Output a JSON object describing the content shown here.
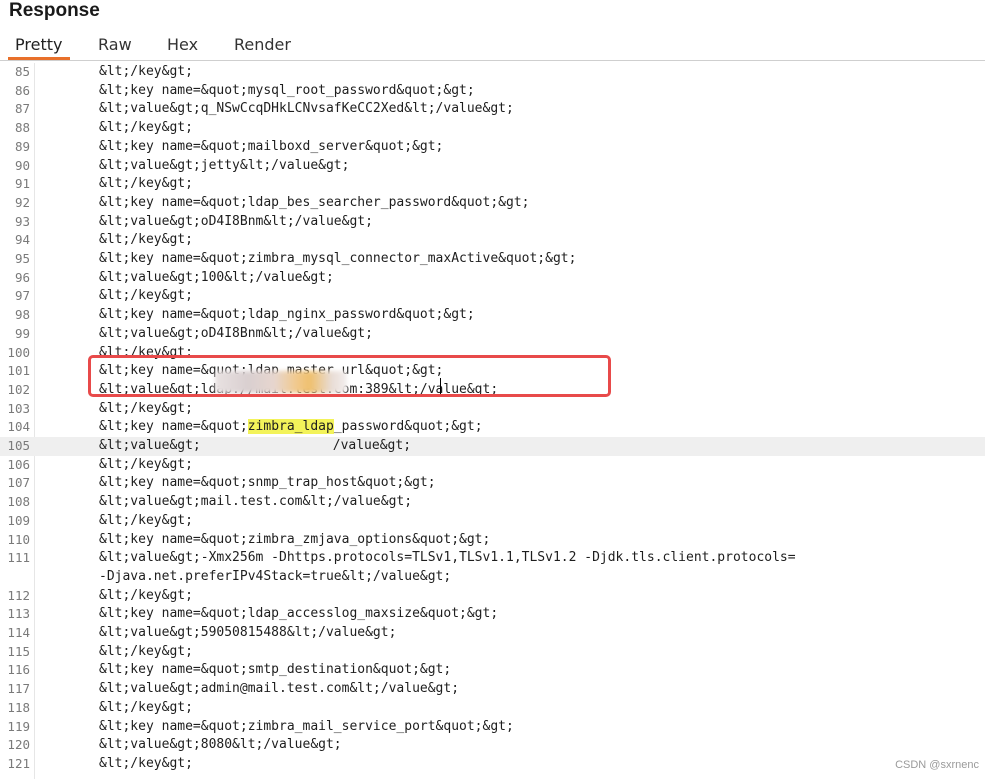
{
  "panel": {
    "title": "Response"
  },
  "tabs": [
    {
      "label": "Pretty",
      "active": true
    },
    {
      "label": "Raw",
      "active": false
    },
    {
      "label": "Hex",
      "active": false
    },
    {
      "label": "Render",
      "active": false
    }
  ],
  "editor": {
    "highlight_color": "#f3f35a",
    "annotation_box_color": "#e84a4a",
    "accent_color": "#e8702a",
    "lines": [
      {
        "number": "85",
        "text": "&lt;/key&gt;"
      },
      {
        "number": "86",
        "text": "&lt;key name=&quot;mysql_root_password&quot;&gt;"
      },
      {
        "number": "87",
        "text": "&lt;value&gt;q_NSwCcqDHkLCNvsafKeCC2Xed&lt;/value&gt;"
      },
      {
        "number": "88",
        "text": "&lt;/key&gt;"
      },
      {
        "number": "89",
        "text": "&lt;key name=&quot;mailboxd_server&quot;&gt;"
      },
      {
        "number": "90",
        "text": "&lt;value&gt;jetty&lt;/value&gt;"
      },
      {
        "number": "91",
        "text": "&lt;/key&gt;"
      },
      {
        "number": "92",
        "text": "&lt;key name=&quot;ldap_bes_searcher_password&quot;&gt;"
      },
      {
        "number": "93",
        "text": "&lt;value&gt;oD4I8Bnm&lt;/value&gt;"
      },
      {
        "number": "94",
        "text": "&lt;/key&gt;"
      },
      {
        "number": "95",
        "text": "&lt;key name=&quot;zimbra_mysql_connector_maxActive&quot;&gt;"
      },
      {
        "number": "96",
        "text": "&lt;value&gt;100&lt;/value&gt;"
      },
      {
        "number": "97",
        "text": "&lt;/key&gt;"
      },
      {
        "number": "98",
        "text": "&lt;key name=&quot;ldap_nginx_password&quot;&gt;"
      },
      {
        "number": "99",
        "text": "&lt;value&gt;oD4I8Bnm&lt;/value&gt;"
      },
      {
        "number": "100",
        "text": "&lt;/key&gt;"
      },
      {
        "number": "101",
        "text": "&lt;key name=&quot;ldap_master_url&quot;&gt;"
      },
      {
        "number": "102",
        "text": "&lt;value&gt;ldap://mail.test.com:389&lt;/value&gt;"
      },
      {
        "number": "103",
        "text": "&lt;/key&gt;"
      },
      {
        "number": "104",
        "pre": "&lt;key name=&quot;",
        "highlighted": "zimbra_ldap",
        "post": "_password&quot;&gt;"
      },
      {
        "number": "105",
        "pre": "&lt;value&gt;",
        "post": "/value&gt;"
      },
      {
        "number": "106",
        "text": "&lt;/key&gt;"
      },
      {
        "number": "107",
        "text": "&lt;key name=&quot;snmp_trap_host&quot;&gt;"
      },
      {
        "number": "108",
        "text": "&lt;value&gt;mail.test.com&lt;/value&gt;"
      },
      {
        "number": "109",
        "text": "&lt;/key&gt;"
      },
      {
        "number": "110",
        "text": "&lt;key name=&quot;zimbra_zmjava_options&quot;&gt;"
      },
      {
        "number": "111",
        "text": "&lt;value&gt;-Xmx256m -Dhttps.protocols=TLSv1,TLSv1.1,TLSv1.2 -Djdk.tls.client.protocols="
      },
      {
        "number": "",
        "text": "-Djava.net.preferIPv4Stack=true&lt;/value&gt;"
      },
      {
        "number": "112",
        "text": "&lt;/key&gt;"
      },
      {
        "number": "113",
        "text": "&lt;key name=&quot;ldap_accesslog_maxsize&quot;&gt;"
      },
      {
        "number": "114",
        "text": "&lt;value&gt;59050815488&lt;/value&gt;"
      },
      {
        "number": "115",
        "text": "&lt;/key&gt;"
      },
      {
        "number": "116",
        "text": "&lt;key name=&quot;smtp_destination&quot;&gt;"
      },
      {
        "number": "117",
        "text": "&lt;value&gt;admin@mail.test.com&lt;/value&gt;"
      },
      {
        "number": "118",
        "text": "&lt;/key&gt;"
      },
      {
        "number": "119",
        "text": "&lt;key name=&quot;zimbra_mail_service_port&quot;&gt;"
      },
      {
        "number": "120",
        "text": "&lt;value&gt;8080&lt;/value&gt;"
      },
      {
        "number": "121",
        "text": "&lt;/key&gt;"
      }
    ]
  },
  "watermark": "CSDN @sxrnenc"
}
